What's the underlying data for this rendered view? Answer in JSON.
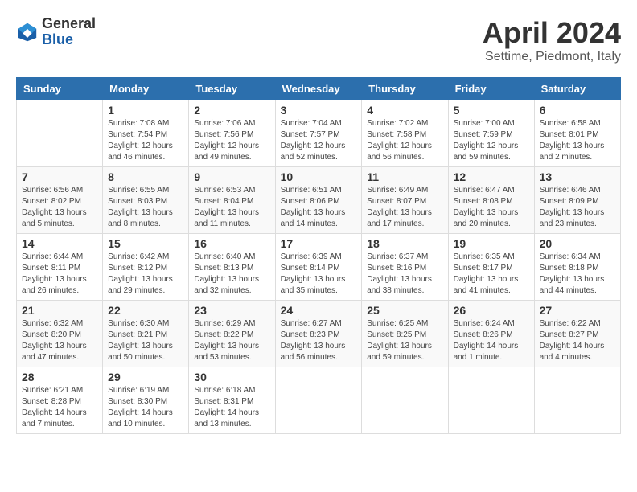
{
  "header": {
    "title": "April 2024",
    "location": "Settime, Piedmont, Italy",
    "logo_general": "General",
    "logo_blue": "Blue"
  },
  "columns": [
    "Sunday",
    "Monday",
    "Tuesday",
    "Wednesday",
    "Thursday",
    "Friday",
    "Saturday"
  ],
  "weeks": [
    [
      {
        "day": "",
        "sunrise": "",
        "sunset": "",
        "daylight": ""
      },
      {
        "day": "1",
        "sunrise": "Sunrise: 7:08 AM",
        "sunset": "Sunset: 7:54 PM",
        "daylight": "Daylight: 12 hours and 46 minutes."
      },
      {
        "day": "2",
        "sunrise": "Sunrise: 7:06 AM",
        "sunset": "Sunset: 7:56 PM",
        "daylight": "Daylight: 12 hours and 49 minutes."
      },
      {
        "day": "3",
        "sunrise": "Sunrise: 7:04 AM",
        "sunset": "Sunset: 7:57 PM",
        "daylight": "Daylight: 12 hours and 52 minutes."
      },
      {
        "day": "4",
        "sunrise": "Sunrise: 7:02 AM",
        "sunset": "Sunset: 7:58 PM",
        "daylight": "Daylight: 12 hours and 56 minutes."
      },
      {
        "day": "5",
        "sunrise": "Sunrise: 7:00 AM",
        "sunset": "Sunset: 7:59 PM",
        "daylight": "Daylight: 12 hours and 59 minutes."
      },
      {
        "day": "6",
        "sunrise": "Sunrise: 6:58 AM",
        "sunset": "Sunset: 8:01 PM",
        "daylight": "Daylight: 13 hours and 2 minutes."
      }
    ],
    [
      {
        "day": "7",
        "sunrise": "Sunrise: 6:56 AM",
        "sunset": "Sunset: 8:02 PM",
        "daylight": "Daylight: 13 hours and 5 minutes."
      },
      {
        "day": "8",
        "sunrise": "Sunrise: 6:55 AM",
        "sunset": "Sunset: 8:03 PM",
        "daylight": "Daylight: 13 hours and 8 minutes."
      },
      {
        "day": "9",
        "sunrise": "Sunrise: 6:53 AM",
        "sunset": "Sunset: 8:04 PM",
        "daylight": "Daylight: 13 hours and 11 minutes."
      },
      {
        "day": "10",
        "sunrise": "Sunrise: 6:51 AM",
        "sunset": "Sunset: 8:06 PM",
        "daylight": "Daylight: 13 hours and 14 minutes."
      },
      {
        "day": "11",
        "sunrise": "Sunrise: 6:49 AM",
        "sunset": "Sunset: 8:07 PM",
        "daylight": "Daylight: 13 hours and 17 minutes."
      },
      {
        "day": "12",
        "sunrise": "Sunrise: 6:47 AM",
        "sunset": "Sunset: 8:08 PM",
        "daylight": "Daylight: 13 hours and 20 minutes."
      },
      {
        "day": "13",
        "sunrise": "Sunrise: 6:46 AM",
        "sunset": "Sunset: 8:09 PM",
        "daylight": "Daylight: 13 hours and 23 minutes."
      }
    ],
    [
      {
        "day": "14",
        "sunrise": "Sunrise: 6:44 AM",
        "sunset": "Sunset: 8:11 PM",
        "daylight": "Daylight: 13 hours and 26 minutes."
      },
      {
        "day": "15",
        "sunrise": "Sunrise: 6:42 AM",
        "sunset": "Sunset: 8:12 PM",
        "daylight": "Daylight: 13 hours and 29 minutes."
      },
      {
        "day": "16",
        "sunrise": "Sunrise: 6:40 AM",
        "sunset": "Sunset: 8:13 PM",
        "daylight": "Daylight: 13 hours and 32 minutes."
      },
      {
        "day": "17",
        "sunrise": "Sunrise: 6:39 AM",
        "sunset": "Sunset: 8:14 PM",
        "daylight": "Daylight: 13 hours and 35 minutes."
      },
      {
        "day": "18",
        "sunrise": "Sunrise: 6:37 AM",
        "sunset": "Sunset: 8:16 PM",
        "daylight": "Daylight: 13 hours and 38 minutes."
      },
      {
        "day": "19",
        "sunrise": "Sunrise: 6:35 AM",
        "sunset": "Sunset: 8:17 PM",
        "daylight": "Daylight: 13 hours and 41 minutes."
      },
      {
        "day": "20",
        "sunrise": "Sunrise: 6:34 AM",
        "sunset": "Sunset: 8:18 PM",
        "daylight": "Daylight: 13 hours and 44 minutes."
      }
    ],
    [
      {
        "day": "21",
        "sunrise": "Sunrise: 6:32 AM",
        "sunset": "Sunset: 8:20 PM",
        "daylight": "Daylight: 13 hours and 47 minutes."
      },
      {
        "day": "22",
        "sunrise": "Sunrise: 6:30 AM",
        "sunset": "Sunset: 8:21 PM",
        "daylight": "Daylight: 13 hours and 50 minutes."
      },
      {
        "day": "23",
        "sunrise": "Sunrise: 6:29 AM",
        "sunset": "Sunset: 8:22 PM",
        "daylight": "Daylight: 13 hours and 53 minutes."
      },
      {
        "day": "24",
        "sunrise": "Sunrise: 6:27 AM",
        "sunset": "Sunset: 8:23 PM",
        "daylight": "Daylight: 13 hours and 56 minutes."
      },
      {
        "day": "25",
        "sunrise": "Sunrise: 6:25 AM",
        "sunset": "Sunset: 8:25 PM",
        "daylight": "Daylight: 13 hours and 59 minutes."
      },
      {
        "day": "26",
        "sunrise": "Sunrise: 6:24 AM",
        "sunset": "Sunset: 8:26 PM",
        "daylight": "Daylight: 14 hours and 1 minute."
      },
      {
        "day": "27",
        "sunrise": "Sunrise: 6:22 AM",
        "sunset": "Sunset: 8:27 PM",
        "daylight": "Daylight: 14 hours and 4 minutes."
      }
    ],
    [
      {
        "day": "28",
        "sunrise": "Sunrise: 6:21 AM",
        "sunset": "Sunset: 8:28 PM",
        "daylight": "Daylight: 14 hours and 7 minutes."
      },
      {
        "day": "29",
        "sunrise": "Sunrise: 6:19 AM",
        "sunset": "Sunset: 8:30 PM",
        "daylight": "Daylight: 14 hours and 10 minutes."
      },
      {
        "day": "30",
        "sunrise": "Sunrise: 6:18 AM",
        "sunset": "Sunset: 8:31 PM",
        "daylight": "Daylight: 14 hours and 13 minutes."
      },
      {
        "day": "",
        "sunrise": "",
        "sunset": "",
        "daylight": ""
      },
      {
        "day": "",
        "sunrise": "",
        "sunset": "",
        "daylight": ""
      },
      {
        "day": "",
        "sunrise": "",
        "sunset": "",
        "daylight": ""
      },
      {
        "day": "",
        "sunrise": "",
        "sunset": "",
        "daylight": ""
      }
    ]
  ]
}
